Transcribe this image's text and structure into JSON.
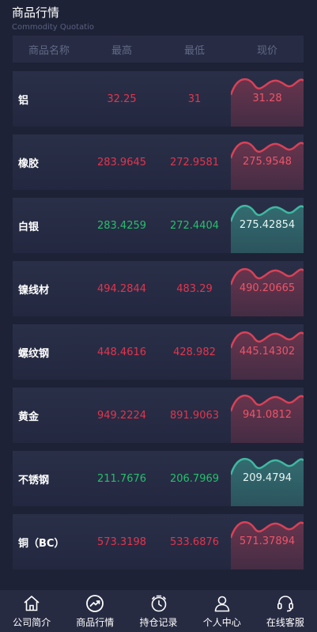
{
  "header": {
    "title": "商品行情",
    "subtitle": "Commodity Quotatio"
  },
  "table": {
    "columns": [
      "商品名称",
      "最高",
      "最低",
      "现价"
    ],
    "rows": [
      {
        "name": "铝",
        "high": "32.25",
        "low": "31",
        "current": "31.28",
        "trend": "down"
      },
      {
        "name": "橡胶",
        "high": "283.9645",
        "low": "272.9581",
        "current": "275.9548",
        "trend": "down"
      },
      {
        "name": "白银",
        "high": "283.4259",
        "low": "272.4404",
        "current": "275.42854",
        "trend": "up"
      },
      {
        "name": "镍线材",
        "high": "494.2844",
        "low": "483.29",
        "current": "490.20665",
        "trend": "down"
      },
      {
        "name": "螺纹钢",
        "high": "448.4616",
        "low": "428.982",
        "current": "445.14302",
        "trend": "down"
      },
      {
        "name": "黄金",
        "high": "949.2224",
        "low": "891.9063",
        "current": "941.0812",
        "trend": "down"
      },
      {
        "name": "不锈钢",
        "high": "211.7676",
        "low": "206.7969",
        "current": "209.4794",
        "trend": "up"
      },
      {
        "name": "铜（BC）",
        "high": "573.3198",
        "low": "533.6876",
        "current": "571.37894",
        "trend": "down"
      }
    ]
  },
  "colors": {
    "down": "#e4344d",
    "up": "#25c06b",
    "wave_down": "#d94157",
    "wave_up": "#3fb8a2"
  },
  "tabbar": {
    "items": [
      {
        "label": "公司简介",
        "icon": "home-icon"
      },
      {
        "label": "商品行情",
        "icon": "trend-icon"
      },
      {
        "label": "持仓记录",
        "icon": "timer-icon"
      },
      {
        "label": "个人中心",
        "icon": "person-icon"
      },
      {
        "label": "在线客服",
        "icon": "headset-icon"
      }
    ]
  }
}
